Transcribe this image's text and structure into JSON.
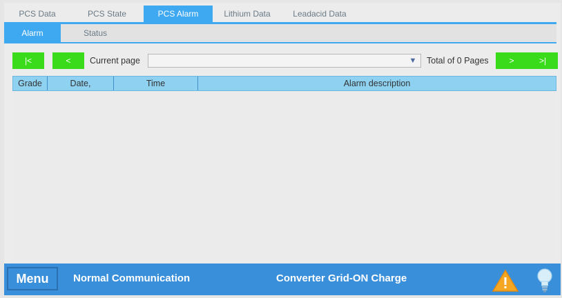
{
  "top_tabs": [
    {
      "label": "PCS Data",
      "active": false
    },
    {
      "label": "PCS State",
      "active": false
    },
    {
      "label": "PCS Alarm",
      "active": true
    },
    {
      "label": "Lithium Data",
      "active": false
    },
    {
      "label": "Leadacid Data",
      "active": false
    }
  ],
  "sub_tabs": [
    {
      "label": "Alarm",
      "active": true
    },
    {
      "label": "Status",
      "active": false
    }
  ],
  "pager": {
    "first_label": "|<",
    "prev_label": "<",
    "current_page_label": "Current page",
    "current_page_value": "",
    "total_label": "Total of 0 Pages",
    "next_label": ">",
    "last_label": ">|"
  },
  "table": {
    "columns": [
      "Grade",
      "Date,",
      "Time",
      "Alarm description"
    ],
    "rows": []
  },
  "footer": {
    "menu_label": "Menu",
    "communication_status": "Normal Communication",
    "converter_status": "Converter Grid-ON Charge",
    "warning_icon": "warning-triangle-icon",
    "light_icon": "lightbulb-icon"
  },
  "colors": {
    "accent": "#3ea8f0",
    "pager_button": "#3adb1a",
    "header": "#8ed1f0",
    "footer": "#3a8fdb",
    "warning": "#f5a623"
  }
}
